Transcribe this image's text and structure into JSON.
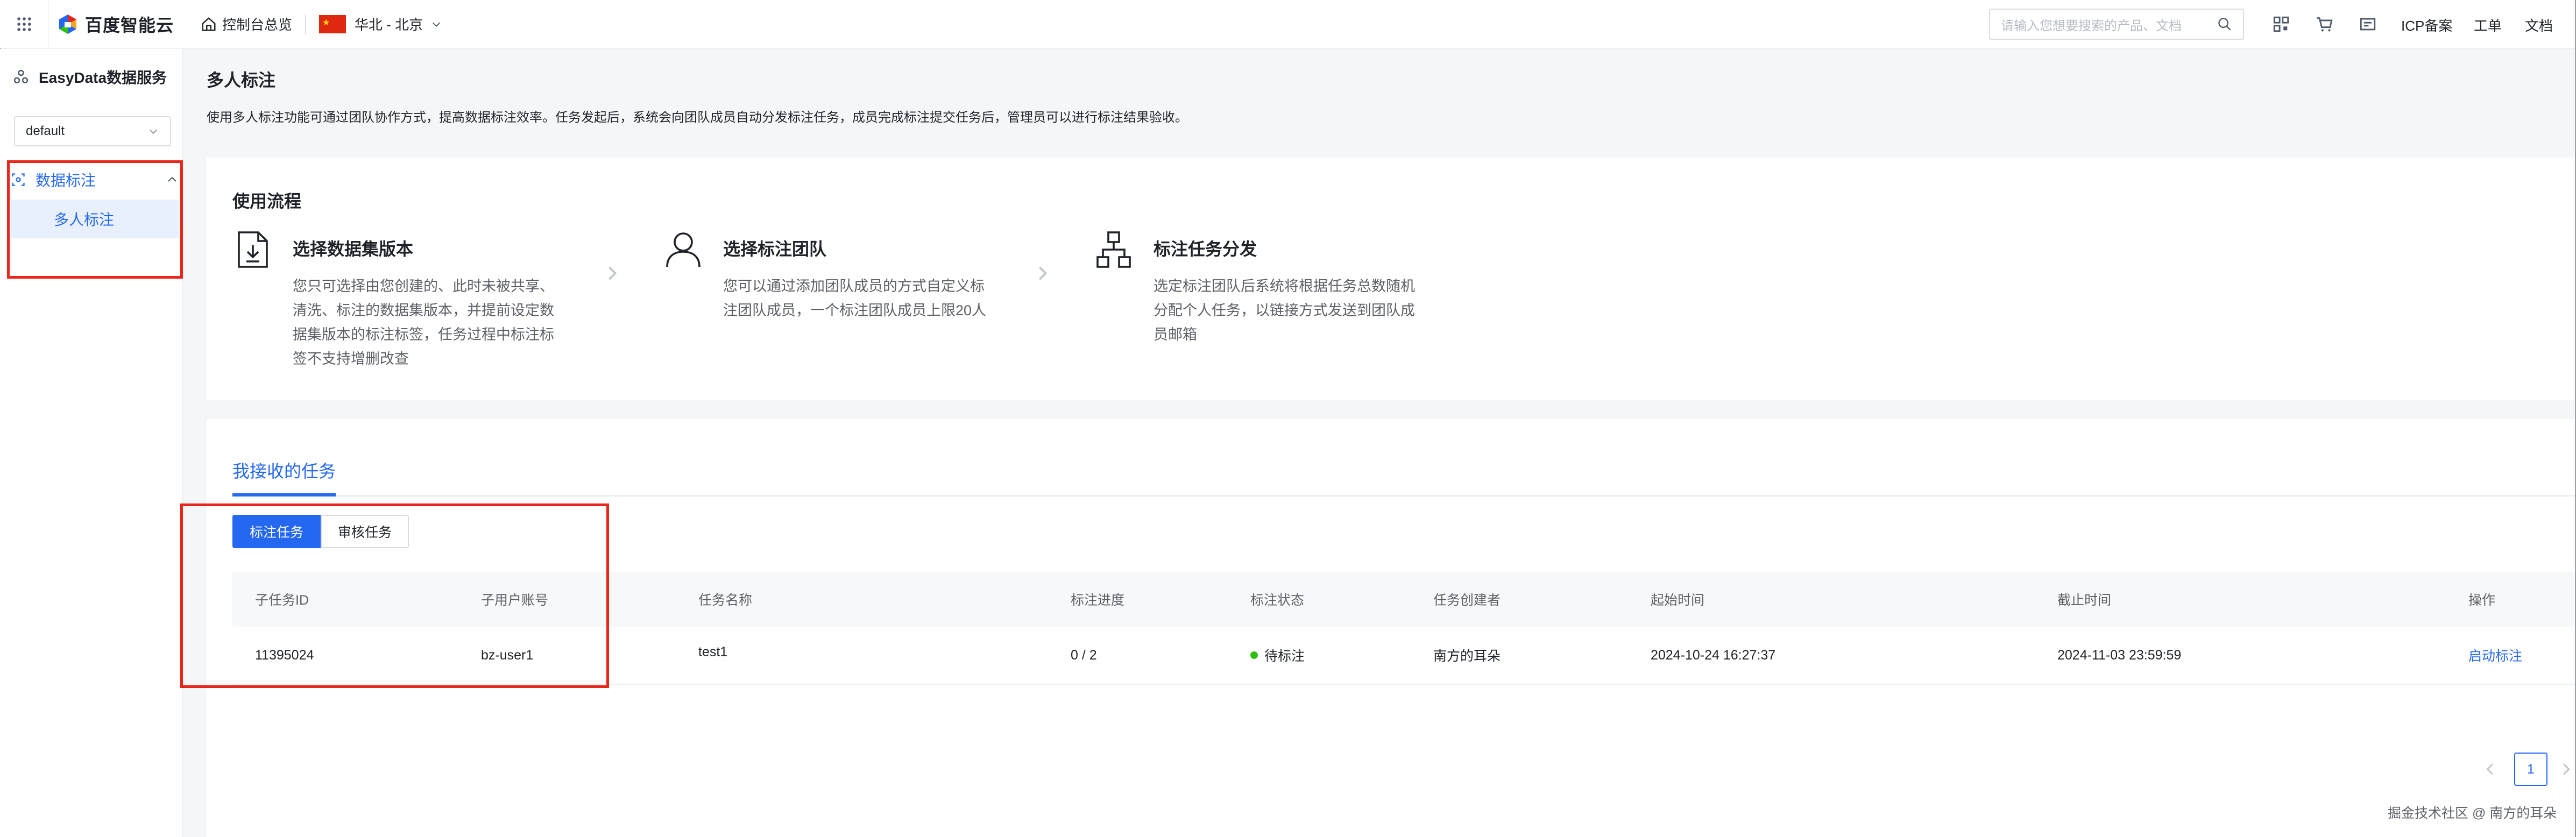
{
  "topbar": {
    "brand": "百度智能云",
    "console_label": "控制台总览",
    "region": "华北 - 北京",
    "search_placeholder": "请输入您想要搜索的产品、文档",
    "icp_label": "ICP备案",
    "ticket_label": "工单",
    "docs_label": "文档",
    "icons": [
      "apps-grid-icon",
      "home-icon",
      "china-flag-icon",
      "search-icon",
      "qrcode-icon",
      "cart-icon",
      "message-icon"
    ]
  },
  "sidebar": {
    "service_title": "EasyData数据服务",
    "workspace_select": "default",
    "group_label": "数据标注",
    "active_item": "多人标注"
  },
  "header": {
    "title": "多人标注",
    "description": "使用多人标注功能可通过团队协作方式，提高数据标注效率。任务发起后，系统会向团队成员自动分发标注任务，成员完成标注提交任务后，管理员可以进行标注结果验收。"
  },
  "flow": {
    "title": "使用流程",
    "steps": [
      {
        "title": "选择数据集版本",
        "desc": "您只可选择由您创建的、此时未被共享、清洗、标注的数据集版本，并提前设定数据集版本的标注标签，任务过程中标注标签不支持增删改查"
      },
      {
        "title": "选择标注团队",
        "desc": "您可以通过添加团队成员的方式自定义标注团队成员，一个标注团队成员上限20人"
      },
      {
        "title": "标注任务分发",
        "desc": "选定标注团队后系统将根据任务总数随机分配个人任务，以链接方式发送到团队成员邮箱"
      }
    ]
  },
  "tasks": {
    "tab_label": "我接收的任务",
    "btn_annotate": "标注任务",
    "btn_review": "审核任务",
    "columns": [
      "子任务ID",
      "子用户账号",
      "任务名称",
      "标注进度",
      "标注状态",
      "任务创建者",
      "起始时间",
      "截止时间",
      "操作"
    ],
    "rows": [
      {
        "id": "11395024",
        "account": "bz-user1",
        "name": "test1",
        "progress": "0 / 2",
        "status": "待标注",
        "creator": "南方的耳朵",
        "start": "2024-10-24 16:27:37",
        "end": "2024-11-03 23:59:59",
        "action": "启动标注"
      }
    ],
    "page": "1"
  },
  "watermark": "掘金技术社区 @ 南方的耳朵",
  "colors": {
    "accent": "#2468f2",
    "highlight": "#e8261b",
    "status_ok": "#30bf13"
  }
}
